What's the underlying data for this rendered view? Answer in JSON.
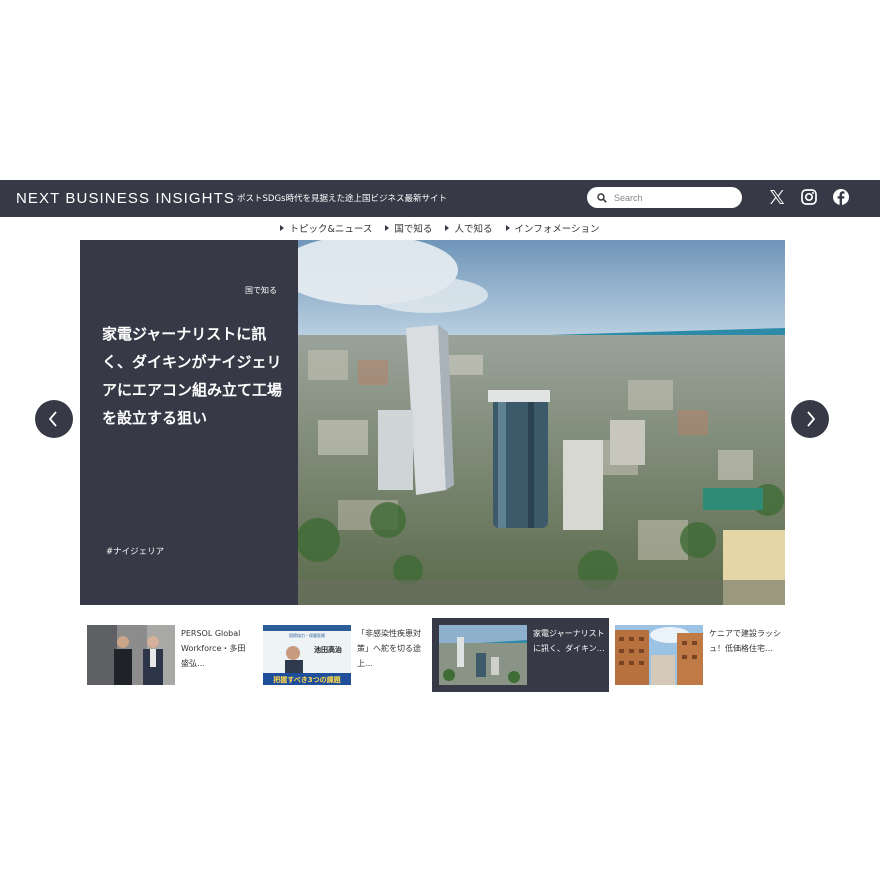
{
  "header": {
    "logo": "NEXT BUSINESS INSIGHTS",
    "tagline": "ポストSDGs時代を見据えた途上国ビジネス最新サイト",
    "search_placeholder": "Search",
    "social": [
      "x-icon",
      "instagram-icon",
      "facebook-icon"
    ]
  },
  "nav": {
    "items": [
      "トピック&ニュース",
      "国で知る",
      "人で知る",
      "インフォメーション"
    ]
  },
  "hero": {
    "category": "国で知る",
    "title": "家電ジャーナリストに訊く、ダイキンがナイジェリアにエアコン組み立て工場を設立する狙い",
    "tag": "#ナイジェリア"
  },
  "cards": [
    {
      "text": "PERSOL Global Workforce・多田盛弘…",
      "active": false
    },
    {
      "text": "「非感染性疾患対策」へ舵を切る途上…",
      "active": false
    },
    {
      "text": "家電ジャーナリストに訊く、ダイキン…",
      "active": true
    },
    {
      "text": "ケニアで建設ラッシュ！低価格住宅…",
      "active": false
    }
  ],
  "thumb_texts": {
    "card2_name": "池田高治",
    "card2_banner": "把握すべき3つの課題"
  },
  "colors": {
    "dark": "#373a46",
    "white": "#ffffff",
    "sea": "#2e8ba8"
  }
}
